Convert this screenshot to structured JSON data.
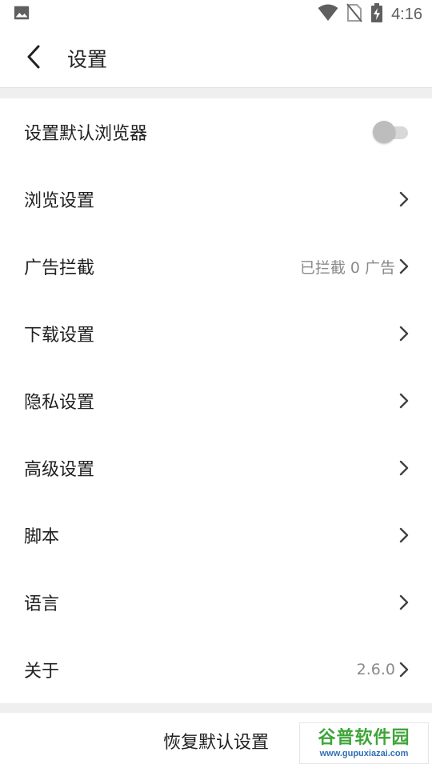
{
  "status_bar": {
    "time": "4:16",
    "icons": [
      "image-icon",
      "wifi-icon",
      "no-sim-icon",
      "battery-charging-icon"
    ]
  },
  "app_bar": {
    "title": "设置",
    "back_icon": "back-arrow-icon"
  },
  "settings": {
    "default_browser": {
      "label": "设置默认浏览器",
      "enabled": false
    },
    "browse": {
      "label": "浏览设置"
    },
    "ad_block": {
      "label": "广告拦截",
      "value": "已拦截 0 广告"
    },
    "download": {
      "label": "下载设置"
    },
    "privacy": {
      "label": "隐私设置"
    },
    "advanced": {
      "label": "高级设置"
    },
    "script": {
      "label": "脚本"
    },
    "language": {
      "label": "语言"
    },
    "about": {
      "label": "关于",
      "value": "2.6.0"
    }
  },
  "footer": {
    "restore_label": "恢复默认设置"
  },
  "watermark": {
    "title": "谷普软件园",
    "url": "www.gupuxiazai.com"
  },
  "colors": {
    "text": "#212121",
    "secondary_text": "#8a8a8a",
    "divider": "#efefef",
    "watermark_green": "#3fa53a",
    "watermark_blue": "#2f6fb6"
  }
}
